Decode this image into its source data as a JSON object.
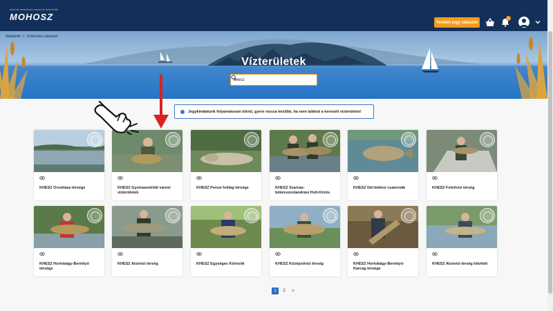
{
  "header": {
    "logo_small": "MAGYAR ORSZÁGOS HORGÁSZ SZÖVETSÉG",
    "logo_main": "MOHOSZ",
    "cta_label": "Területi jegy választó",
    "notification_count": "1",
    "colors": {
      "bar": "#13305a",
      "accent": "#f39a1a"
    }
  },
  "breadcrumb": {
    "home": "Áttekintő",
    "separator": ">",
    "current": "Vízterület választó"
  },
  "hero": {
    "title": "Vízterületek"
  },
  "search": {
    "value": "khesz",
    "placeholder": ""
  },
  "notice": {
    "text": "Jegykínálatunk folyamatosan bővül, gyere vissza később, ha nem találod a keresett vízterületet!"
  },
  "cards": [
    {
      "title": "KHESZ Orosháza térsége"
    },
    {
      "title": "KHESZ Gyomaendrődi városi vízterületek"
    },
    {
      "title": "KHESZ Peresi holtág térsége"
    },
    {
      "title": "KHESZ Szarvas-békésszentandrási Holt-Körös"
    },
    {
      "title": "KHESZ Dél-békési csatornák"
    },
    {
      "title": "KHESZ Felsővízi térség"
    },
    {
      "title": "KHESZ Hortobágy-Berettyó térsége"
    },
    {
      "title": "KHESZ Alsóvízi térség"
    },
    {
      "title": "KHESZ Egységes Körösök"
    },
    {
      "title": "KHESZ Középsővízi térség"
    },
    {
      "title": "KHESZ Hortobágy-Berettyó-Karcag térsége"
    },
    {
      "title": "KHESZ Alsóvízi térség bővített"
    }
  ],
  "pagination": {
    "prev": "‹",
    "pages": [
      "1",
      "2"
    ],
    "next": "»",
    "active": "1"
  }
}
